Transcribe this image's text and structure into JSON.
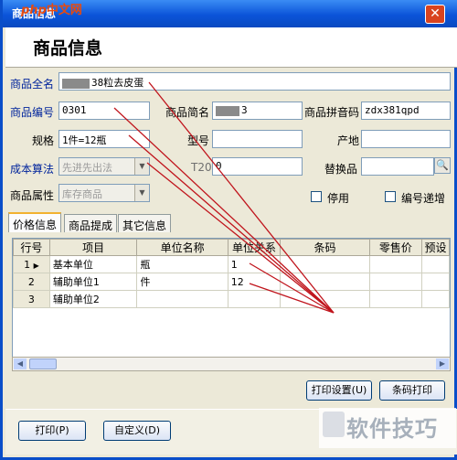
{
  "window": {
    "title": "商品信息",
    "watermark_logo_text": "php中文网"
  },
  "header": {
    "heading": "商品信息"
  },
  "form": {
    "full_name_label": "商品全名",
    "full_name_value": "38粒去皮蛋",
    "code_label": "商品编号",
    "code_value": "0301",
    "short_name_label": "商品简名",
    "short_name_value": "3",
    "pinyin_label": "商品拼音码",
    "pinyin_value": "zdx381qpd",
    "spec_label": "规格",
    "spec_value": "1件=12瓶",
    "model_label": "型号",
    "model_value": "",
    "origin_label": "产地",
    "origin_value": "",
    "cost_method_label": "成本算法",
    "cost_method_value": "先进先出法",
    "t20_label": "T20",
    "t20_value": "0",
    "substitute_label": "替换品",
    "substitute_value": "",
    "attr_label": "商品属性",
    "attr_value": "库存商品",
    "disabled_label": "停用",
    "auto_increment_label": "编号递增"
  },
  "tabs": [
    "价格信息",
    "商品提成",
    "其它信息"
  ],
  "grid": {
    "columns": [
      "行号",
      "项目",
      "单位名称",
      "单位关系",
      "条码",
      "零售价",
      "预设"
    ],
    "rows": [
      {
        "no": "1",
        "item": "基本单位",
        "unit": "瓶",
        "relation": "1"
      },
      {
        "no": "2",
        "item": "辅助单位1",
        "unit": "件",
        "relation": "12"
      },
      {
        "no": "3",
        "item": "辅助单位2",
        "unit": "",
        "relation": ""
      }
    ]
  },
  "buttons": {
    "print_settings": "打印设置(U)",
    "barcode_print": "条码打印",
    "print": "打印(P)",
    "customize": "自定义(D)"
  },
  "footer_watermark": "软件技巧",
  "colors": {
    "title_bar": "#0b54d9",
    "annotation_arrows": "#c0141c",
    "label_blue": "#00249c"
  }
}
